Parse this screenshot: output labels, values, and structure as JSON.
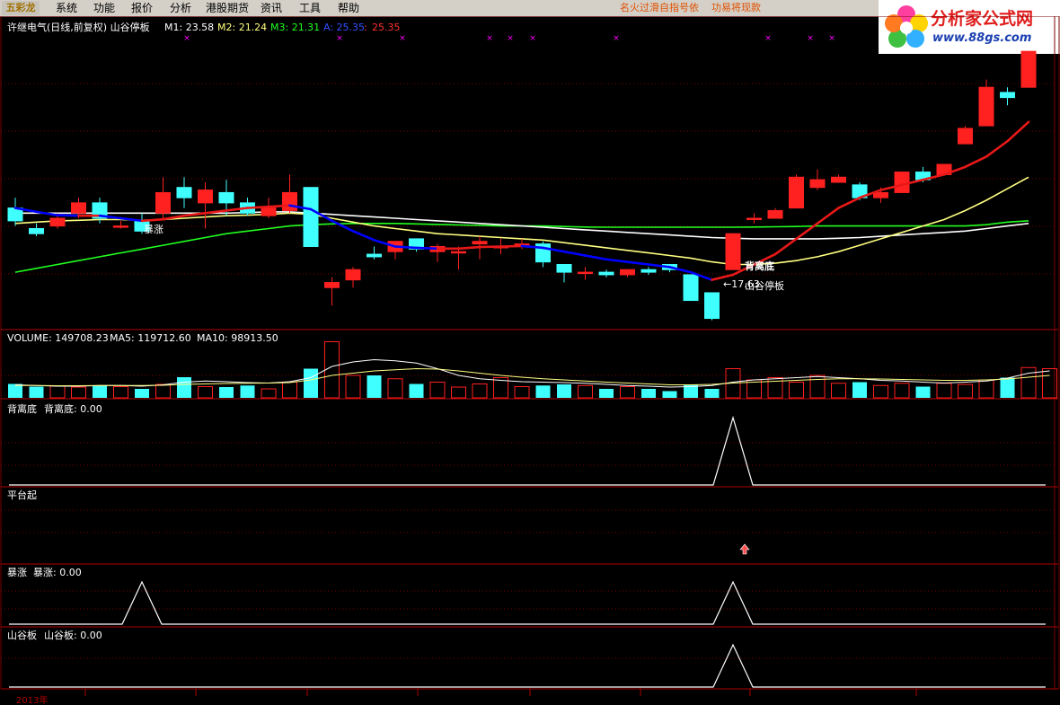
{
  "menubar": {
    "logo_text": "五彩龙",
    "items": [
      {
        "label": "系统"
      },
      {
        "label": "功能"
      },
      {
        "label": "报价"
      },
      {
        "label": "分析"
      },
      {
        "label": "港股期货"
      },
      {
        "label": "资讯"
      },
      {
        "label": "工具"
      },
      {
        "label": "帮助"
      }
    ],
    "ticker": [
      "名火过滑自指号依",
      "功易将现款"
    ]
  },
  "brand": {
    "name": "分析家公式网",
    "url": "www.88gs.com"
  },
  "main_panel": {
    "title": "许继电气(日线,前复权) 山谷停板",
    "m1": "M1: 23.58",
    "m2": "M2: 21.24",
    "m3": "M3: 21.31",
    "a": "A: 25.35",
    "sep": ":",
    "a_val": "25.35",
    "label_baozhang": "暴涨",
    "label_beilidi": "背离底",
    "label_lowprice": "←17.63",
    "label_shangu": "山谷停板"
  },
  "volume_panel": {
    "volume": "VOLUME: 149708.23",
    "ma5": "MA5: 119712.60",
    "ma10": "MA10: 98913.50"
  },
  "beilidi_panel": {
    "name": "背离底",
    "value_text": "背离底: 0.00"
  },
  "pingtai_panel": {
    "name": "平台起"
  },
  "baozhang_panel": {
    "name": "暴涨",
    "value_text": "暴涨: 0.00"
  },
  "shangu_panel": {
    "name": "山谷板",
    "value_text": "山谷板: 0.00"
  },
  "timeline": {
    "year": "2013年"
  },
  "colors": {
    "up": "#ff2020",
    "down": "#40ffff",
    "m1": "#ffffff",
    "m2": "#ffff80",
    "m3": "#20ff20",
    "a_line": "#0000ff",
    "a_up": "#e81818",
    "grid": "#7a0000",
    "marker": "#ff00ff"
  },
  "chart_data": {
    "type": "candlestick",
    "candles": [
      [
        22.0,
        21.5,
        22.4,
        21.3
      ],
      [
        21.2,
        21.0,
        21.4,
        20.9
      ],
      [
        21.3,
        21.6,
        21.8,
        21.2
      ],
      [
        21.8,
        22.2,
        22.4,
        21.6
      ],
      [
        22.2,
        21.6,
        22.4,
        21.4
      ],
      [
        21.3,
        21.3,
        21.5,
        21.2
      ],
      [
        21.5,
        21.1,
        21.8,
        21.0
      ],
      [
        21.8,
        22.6,
        23.2,
        21.6
      ],
      [
        22.8,
        22.4,
        23.2,
        22.0
      ],
      [
        22.2,
        22.7,
        23.0,
        21.2
      ],
      [
        22.6,
        22.2,
        23.1,
        21.7
      ],
      [
        22.2,
        21.8,
        22.4,
        21.7
      ],
      [
        21.7,
        22.0,
        22.4,
        21.6
      ],
      [
        21.9,
        22.6,
        23.3,
        21.8
      ],
      [
        22.8,
        20.5,
        22.8,
        20.5
      ],
      [
        18.9,
        19.1,
        19.3,
        18.2
      ],
      [
        19.2,
        19.6,
        19.7,
        18.9
      ],
      [
        20.2,
        20.1,
        20.5,
        20.0
      ],
      [
        20.3,
        20.7,
        20.7,
        20.0
      ],
      [
        20.8,
        20.4,
        20.8,
        20.3
      ],
      [
        20.3,
        20.5,
        20.6,
        19.9
      ],
      [
        20.3,
        20.3,
        20.5,
        19.6
      ],
      [
        20.6,
        20.7,
        20.9,
        20.0
      ],
      [
        20.5,
        20.5,
        20.8,
        20.2
      ],
      [
        20.6,
        20.6,
        20.8,
        20.4
      ],
      [
        20.6,
        19.9,
        20.7,
        19.7
      ],
      [
        19.8,
        19.5,
        19.8,
        19.1
      ],
      [
        19.5,
        19.5,
        19.7,
        19.2
      ],
      [
        19.5,
        19.4,
        19.6,
        19.3
      ],
      [
        19.4,
        19.6,
        19.6,
        19.3
      ],
      [
        19.6,
        19.5,
        19.7,
        19.4
      ],
      [
        19.8,
        19.6,
        19.8,
        19.5
      ],
      [
        19.4,
        18.4,
        19.4,
        18.4
      ],
      [
        18.7,
        17.7,
        18.7,
        17.63
      ],
      [
        19.6,
        21.0,
        21.0,
        19.6
      ],
      [
        21.6,
        21.6,
        21.8,
        21.4
      ],
      [
        21.6,
        21.9,
        22.0,
        21.6
      ],
      [
        22.0,
        23.2,
        23.3,
        22.0
      ],
      [
        22.8,
        23.1,
        23.5,
        22.7
      ],
      [
        23.0,
        23.2,
        23.3,
        23.0
      ],
      [
        22.9,
        22.4,
        23.0,
        22.3
      ],
      [
        22.4,
        22.6,
        22.8,
        22.2
      ],
      [
        22.6,
        23.4,
        23.4,
        22.6
      ],
      [
        23.4,
        23.1,
        23.6,
        23.0
      ],
      [
        23.3,
        23.7,
        23.7,
        23.3
      ],
      [
        24.5,
        25.1,
        25.2,
        24.5
      ],
      [
        25.2,
        26.7,
        27.0,
        25.2
      ],
      [
        26.5,
        26.3,
        26.7,
        26.0
      ],
      [
        26.7,
        28.1,
        28.1,
        26.7
      ]
    ],
    "m1": [
      22.0,
      21.85,
      21.72,
      21.7,
      21.7,
      21.6,
      21.5,
      21.56,
      21.7,
      21.8,
      21.9,
      22.0,
      22.05,
      22.1,
      21.95,
      21.5,
      21.1,
      20.75,
      20.5,
      20.45,
      20.42,
      20.42,
      20.48,
      20.5,
      20.52,
      20.45,
      20.3,
      20.15,
      20.0,
      19.9,
      19.8,
      19.7,
      19.5,
      19.2,
      19.4,
      19.8,
      20.2,
      20.8,
      21.4,
      22.0,
      22.4,
      22.7,
      22.9,
      23.1,
      23.3,
      23.6,
      24.0,
      24.6,
      25.35
    ],
    "m2": [
      21.4,
      21.45,
      21.5,
      21.52,
      21.55,
      21.55,
      21.52,
      21.55,
      21.6,
      21.65,
      21.7,
      21.72,
      21.75,
      21.8,
      21.75,
      21.6,
      21.45,
      21.3,
      21.2,
      21.1,
      21.0,
      20.95,
      20.9,
      20.85,
      20.8,
      20.75,
      20.65,
      20.55,
      20.45,
      20.35,
      20.25,
      20.15,
      20.05,
      19.9,
      19.8,
      19.8,
      19.85,
      19.95,
      20.1,
      20.3,
      20.55,
      20.8,
      21.05,
      21.3,
      21.55,
      21.9,
      22.3,
      22.75,
      23.2
    ],
    "m3": [
      19.5,
      19.65,
      19.8,
      19.95,
      20.1,
      20.25,
      20.4,
      20.55,
      20.7,
      20.85,
      21.0,
      21.1,
      21.2,
      21.3,
      21.35,
      21.38,
      21.4,
      21.4,
      21.4,
      21.38,
      21.36,
      21.34,
      21.32,
      21.3,
      21.3,
      21.3,
      21.28,
      21.26,
      21.25,
      21.25,
      21.25,
      21.25,
      21.25,
      21.25,
      21.25,
      21.26,
      21.27,
      21.28,
      21.3,
      21.3,
      21.3,
      21.3,
      21.3,
      21.3,
      21.3,
      21.3,
      21.35,
      21.45,
      21.5
    ],
    "m4": [
      21.8,
      21.8,
      21.8,
      21.8,
      21.8,
      21.8,
      21.8,
      21.8,
      21.8,
      21.8,
      21.8,
      21.82,
      21.85,
      21.85,
      21.8,
      21.75,
      21.7,
      21.65,
      21.6,
      21.55,
      21.5,
      21.45,
      21.4,
      21.35,
      21.3,
      21.25,
      21.2,
      21.15,
      21.1,
      21.05,
      21.0,
      20.95,
      20.9,
      20.85,
      20.82,
      20.8,
      20.8,
      20.8,
      20.8,
      20.82,
      20.85,
      20.9,
      20.95,
      21.0,
      21.05,
      21.1,
      21.2,
      21.3,
      21.4
    ],
    "volume": [
      0.62,
      0.5,
      0.52,
      0.48,
      0.55,
      0.5,
      0.4,
      0.6,
      0.92,
      0.5,
      0.48,
      0.55,
      0.4,
      0.7,
      1.3,
      2.5,
      1.0,
      1.0,
      0.85,
      0.62,
      0.7,
      0.48,
      0.62,
      0.9,
      0.5,
      0.55,
      0.6,
      0.55,
      0.4,
      0.5,
      0.4,
      0.3,
      0.6,
      0.4,
      1.3,
      0.8,
      0.9,
      0.7,
      1.0,
      0.65,
      0.7,
      0.55,
      0.65,
      0.5,
      0.65,
      0.6,
      0.8,
      0.9,
      1.35,
      1.3
    ],
    "volume_ma5": [
      0.58,
      0.55,
      0.52,
      0.52,
      0.55,
      0.55,
      0.52,
      0.58,
      0.7,
      0.75,
      0.72,
      0.68,
      0.66,
      0.72,
      0.9,
      1.4,
      1.6,
      1.7,
      1.65,
      1.55,
      1.3,
      1.0,
      0.85,
      0.78,
      0.72,
      0.7,
      0.68,
      0.65,
      0.6,
      0.55,
      0.52,
      0.48,
      0.5,
      0.55,
      0.7,
      0.8,
      0.85,
      0.9,
      0.95,
      0.9,
      0.85,
      0.78,
      0.75,
      0.7,
      0.66,
      0.7,
      0.75,
      0.88,
      1.1,
      1.2
    ],
    "volume_ma10": [
      0.55,
      0.55,
      0.54,
      0.54,
      0.55,
      0.55,
      0.55,
      0.56,
      0.6,
      0.62,
      0.64,
      0.65,
      0.66,
      0.68,
      0.8,
      1.0,
      1.1,
      1.2,
      1.25,
      1.3,
      1.28,
      1.2,
      1.1,
      1.0,
      0.92,
      0.85,
      0.8,
      0.75,
      0.7,
      0.66,
      0.62,
      0.58,
      0.58,
      0.6,
      0.66,
      0.7,
      0.74,
      0.78,
      0.82,
      0.85,
      0.85,
      0.84,
      0.82,
      0.8,
      0.78,
      0.78,
      0.8,
      0.84,
      0.92,
      1.0
    ],
    "signal_beilidi_index": 34,
    "signal_baozhang_indices": [
      6,
      34
    ],
    "signal_shangu_index": 34,
    "signal_pingtai_index": 34
  }
}
